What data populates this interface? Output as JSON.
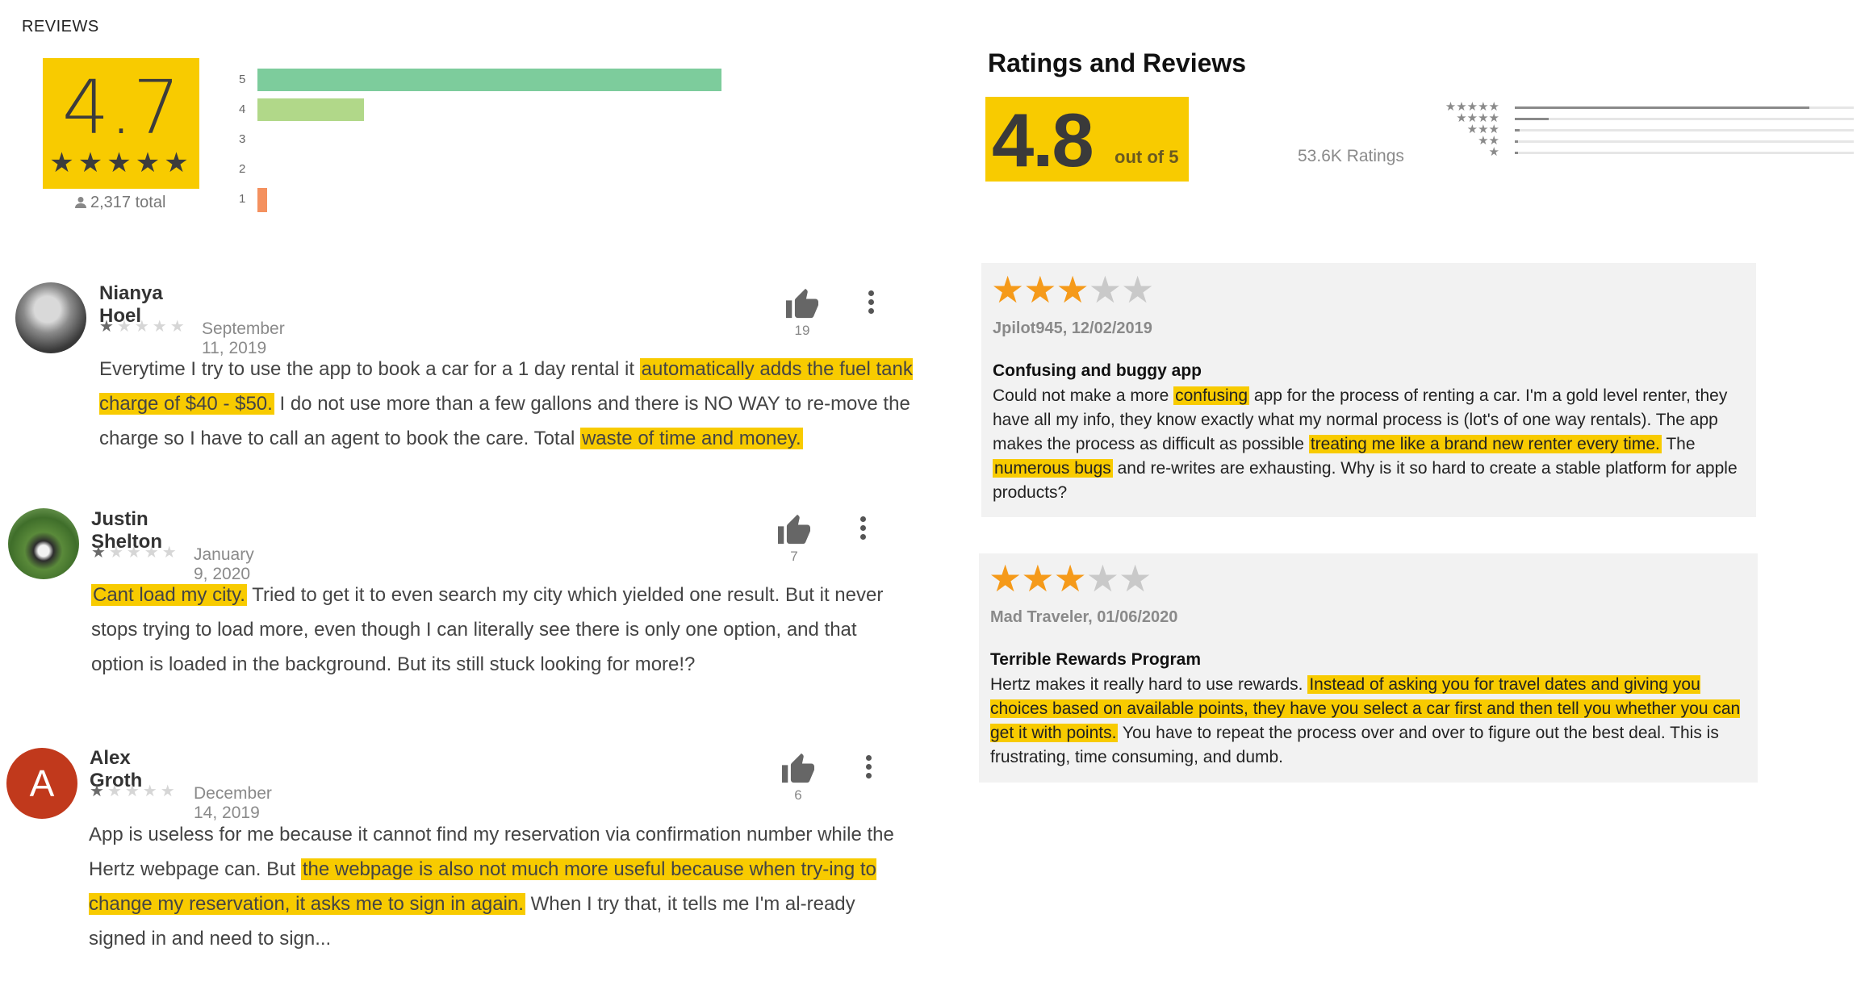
{
  "google": {
    "heading": "REVIEWS",
    "score": "4.7",
    "score_stars": "★★★★★",
    "total": "2,317 total",
    "distribution": [
      {
        "label": "5",
        "fraction": 1.0,
        "color": "#7dcc9c"
      },
      {
        "label": "4",
        "fraction": 0.23,
        "color": "#b1d889"
      },
      {
        "label": "3",
        "fraction": 0.0,
        "color": "#f6d063"
      },
      {
        "label": "2",
        "fraction": 0.0,
        "color": "#f5b56e"
      },
      {
        "label": "1",
        "fraction": 0.02,
        "color": "#f4915f"
      }
    ],
    "reviews": [
      {
        "name": "Nianya Hoel",
        "rating": 1,
        "date": "September 11, 2019",
        "likes": "19",
        "avatar": "photo",
        "text": [
          {
            "t": "Everytime I try to use the app to book a car for a 1 day rental it "
          },
          {
            "t": "automatically adds the fuel tank charge of $40 - $50.",
            "h": true
          },
          {
            "t": " I do not use more than a few gallons and there is NO WAY to re-move the charge so I have to call an agent to book the care. Total "
          },
          {
            "t": "waste of time and money.",
            "h": true
          }
        ]
      },
      {
        "name": "Justin Shelton",
        "rating": 1,
        "date": "January 9, 2020",
        "likes": "7",
        "avatar": "photo-dog",
        "text": [
          {
            "t": "Cant load my city.",
            "h": true
          },
          {
            "t": " Tried to get it to even search my city which yielded one result. But it never stops trying to load more, even though I can literally see there is only one option, and that option is loaded in the background. But its still stuck looking for more!?"
          }
        ]
      },
      {
        "name": "Alex Groth",
        "rating": 1,
        "date": "December 14, 2019",
        "likes": "6",
        "avatar": "letter",
        "avatar_letter": "A",
        "avatar_color": "#c1391c",
        "text": [
          {
            "t": "App is useless for me because it cannot find my reservation via confirmation number while the Hertz webpage can. But "
          },
          {
            "t": "the webpage is also not much more useful because when try-ing to change my reservation, it asks me to sign in again.",
            "h": true
          },
          {
            "t": " When I try that, it tells me I'm al-ready signed in and need to sign..."
          }
        ]
      }
    ]
  },
  "appstore": {
    "title": "Ratings and Reviews",
    "score": "4.8",
    "out_of": "out of 5",
    "count": "53.6K Ratings",
    "histogram": [
      {
        "stars": "★★★★★",
        "fraction": 0.87
      },
      {
        "stars": "★★★★",
        "fraction": 0.1
      },
      {
        "stars": "★★★",
        "fraction": 0.015
      },
      {
        "stars": "★★",
        "fraction": 0.008
      },
      {
        "stars": "★",
        "fraction": 0.008
      }
    ],
    "reviews": [
      {
        "rating": 3,
        "meta": "Jpilot945, 12/02/2019",
        "title": "Confusing and buggy app",
        "text": [
          {
            "t": "Could not make a more "
          },
          {
            "t": "confusing",
            "h": true
          },
          {
            "t": " app for the process of renting a car. I'm a gold level renter, they have all my info, they know exactly what my normal process is (lot's of one way rentals). The app makes the process as difficult as possible "
          },
          {
            "t": "treating me like a brand new renter every time.",
            "h": true
          },
          {
            "t": " The "
          },
          {
            "t": "numerous bugs",
            "h": true
          },
          {
            "t": " and re-writes are exhausting. Why is it so hard to create a stable platform for apple products?"
          }
        ]
      },
      {
        "rating": 3,
        "meta": "Mad Traveler, 01/06/2020",
        "title": "Terrible Rewards Program",
        "text": [
          {
            "t": "Hertz makes it really hard to use rewards. "
          },
          {
            "t": "Instead of asking you for travel dates and giving you choices based on available points, they have you select a car first and then tell you whether you can get it with points.",
            "h": true
          },
          {
            "t": " You have to repeat the process over and over to figure out the best deal. This is frustrating, time consuming, and dumb."
          }
        ]
      }
    ]
  }
}
